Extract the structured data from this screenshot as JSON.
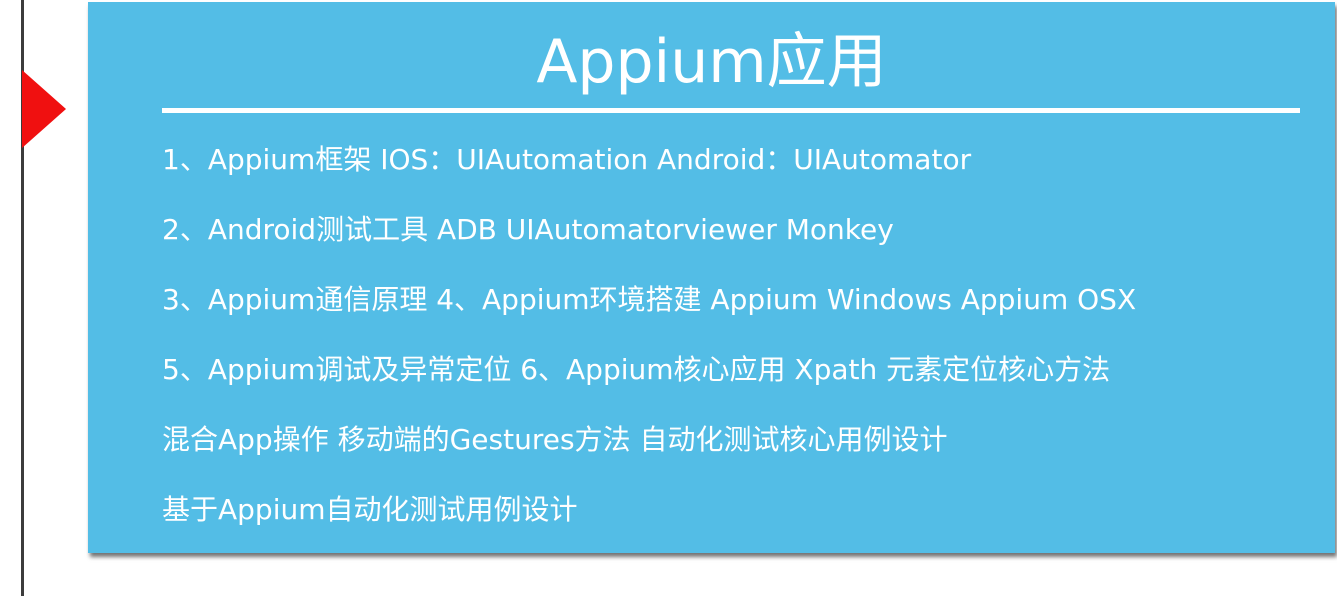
{
  "slide": {
    "title": "Appium应用",
    "lines": [
      "1、Appium框架 IOS：UIAutomation Android：UIAutomator",
      "2、Android测试工具 ADB UIAutomatorviewer Monkey",
      "3、Appium通信原理  4、Appium环境搭建 Appium Windows  Appium OSX",
      "5、Appium调试及异常定位  6、Appium核心应用 Xpath  元素定位核心方法",
      "混合App操作  移动端的Gestures方法  自动化测试核心用例设计",
      "基于Appium自动化测试用例设计"
    ]
  },
  "colors": {
    "panel": "#53bde6",
    "marker": "#f01010",
    "text": "#ffffff",
    "rule": "#3c3c3c"
  }
}
